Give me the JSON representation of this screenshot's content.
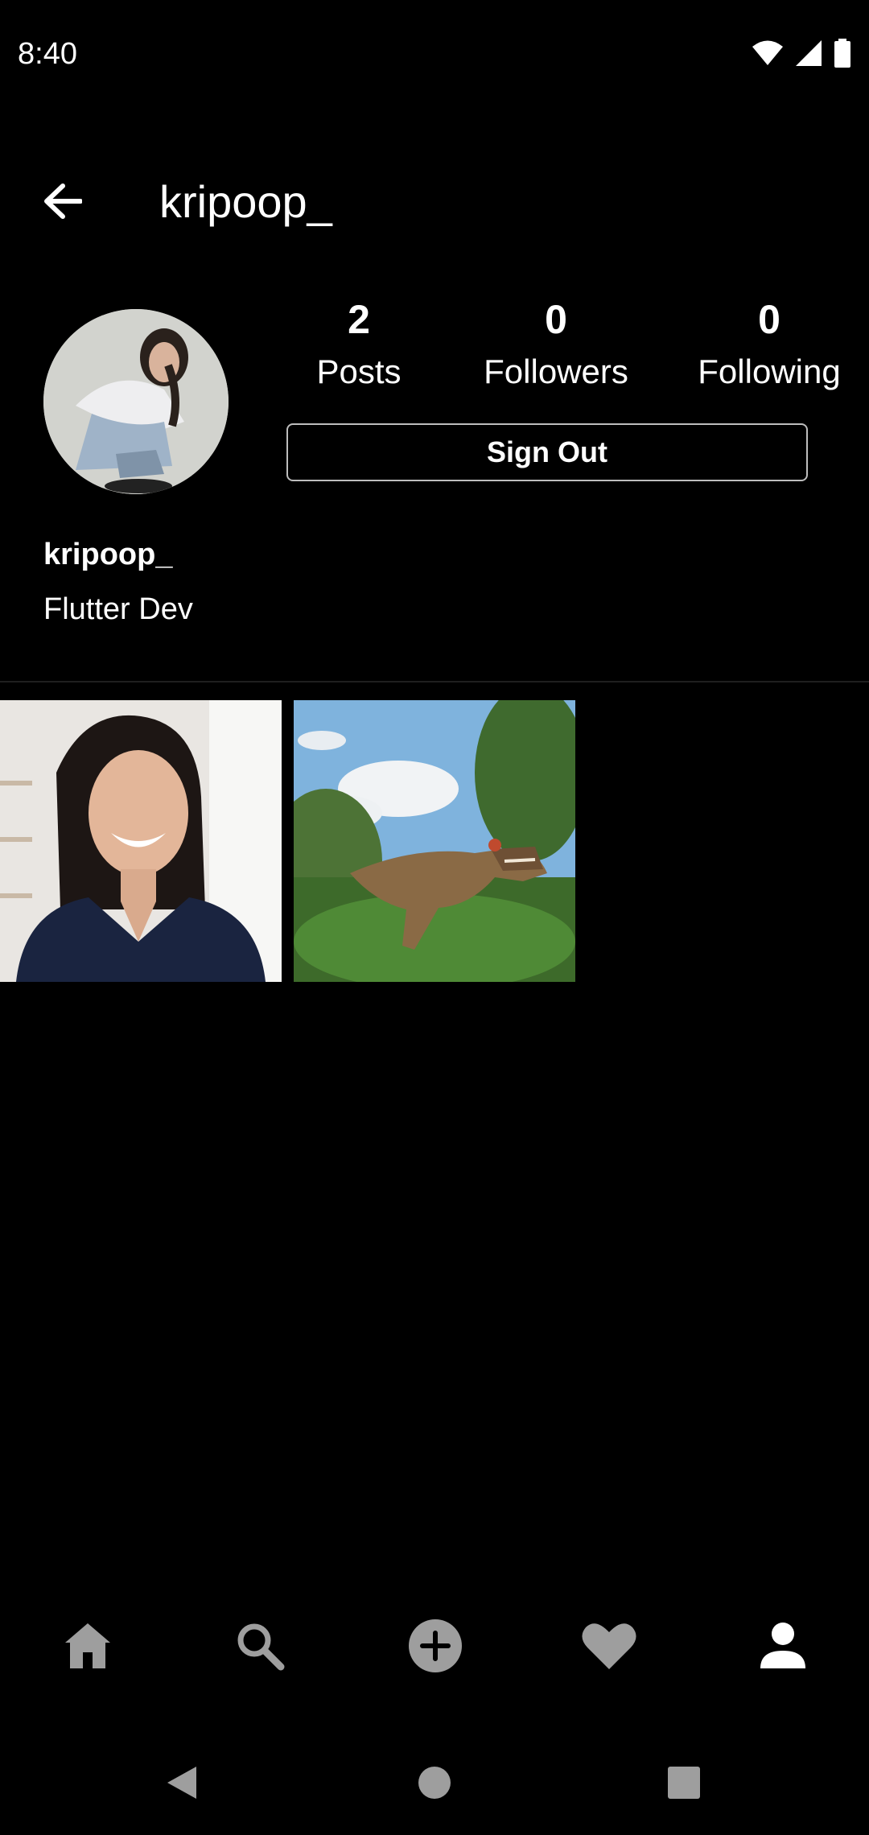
{
  "status_bar": {
    "time": "8:40",
    "icons": [
      "wifi-icon",
      "cell-signal-icon",
      "battery-icon"
    ]
  },
  "app_bar": {
    "back_icon": "arrow-back-icon",
    "title": "kripoop_"
  },
  "profile": {
    "avatar": "profile-photo",
    "stats": {
      "posts": {
        "value": "2",
        "label": "Posts"
      },
      "followers": {
        "value": "0",
        "label": "Followers"
      },
      "following": {
        "value": "0",
        "label": "Following"
      }
    },
    "sign_out_label": "Sign Out",
    "username": "kripoop_",
    "bio": "Flutter Dev"
  },
  "posts": [
    {
      "image": "smiling-woman-photo"
    },
    {
      "image": "dinosaur-statue-photo"
    }
  ],
  "bottom_nav": {
    "items": [
      "home-icon",
      "search-icon",
      "add-circle-icon",
      "heart-icon",
      "person-icon"
    ],
    "active": "person-icon",
    "active_color": "#ffffff",
    "inactive_color": "#9e9e9e"
  },
  "system_nav": {
    "items": [
      "back-triangle-icon",
      "home-circle-icon",
      "recents-square-icon"
    ]
  }
}
